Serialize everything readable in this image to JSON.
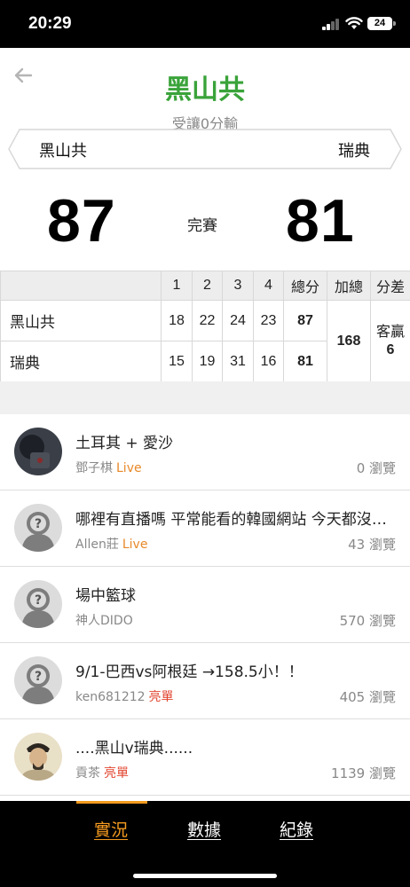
{
  "status_bar": {
    "time": "20:29",
    "battery": "24"
  },
  "header": {
    "title": "黑山共",
    "handicap": "受讓0分輸",
    "home_team": "黑山共",
    "away_team": "瑞典"
  },
  "scoreboard": {
    "home_score": "87",
    "away_score": "81",
    "status": "完賽"
  },
  "box_score": {
    "headers": [
      "",
      "1",
      "2",
      "3",
      "4",
      "總分",
      "加總",
      "分差"
    ],
    "rows": [
      {
        "team": "黑山共",
        "q1": "18",
        "q2": "22",
        "q3": "24",
        "q4": "23",
        "total": "87"
      },
      {
        "team": "瑞典",
        "q1": "15",
        "q2": "19",
        "q3": "31",
        "q4": "16",
        "total": "81"
      }
    ],
    "combined": "168",
    "margin_label": "客贏",
    "margin_value": "6"
  },
  "posts": [
    {
      "title": "土耳其 + 愛沙",
      "author": "鄧子棋",
      "tag": "Live",
      "tag_type": "live",
      "views": "0 瀏覽",
      "avatar": "photo-dark"
    },
    {
      "title": "哪裡有直播嗎 平常能看的韓國網站 今天都沒有直播",
      "author": "Allen莊",
      "tag": "Live",
      "tag_type": "live",
      "views": "43 瀏覽",
      "avatar": "placeholder"
    },
    {
      "title": "場中籃球",
      "author": "神人DIDO",
      "tag": "",
      "tag_type": "",
      "views": "570 瀏覽",
      "avatar": "placeholder"
    },
    {
      "title": "9/1-巴西vs阿根廷 →158.5小！！",
      "author": "ken681212",
      "tag": "亮單",
      "tag_type": "hot",
      "views": "405 瀏覽",
      "avatar": "placeholder"
    },
    {
      "title": "....黑山v瑞典......",
      "author": "貢茶",
      "tag": "亮單",
      "tag_type": "hot",
      "views": "1139 瀏覽",
      "avatar": "portrait"
    }
  ],
  "tabs": [
    {
      "label": "實況",
      "active": true
    },
    {
      "label": "數據",
      "active": false
    },
    {
      "label": "紀錄",
      "active": false
    }
  ],
  "colors": {
    "brand_green": "#3aa33a",
    "accent_orange": "#f39a21",
    "live_orange": "#e8892a",
    "hot_red": "#e2452f"
  }
}
